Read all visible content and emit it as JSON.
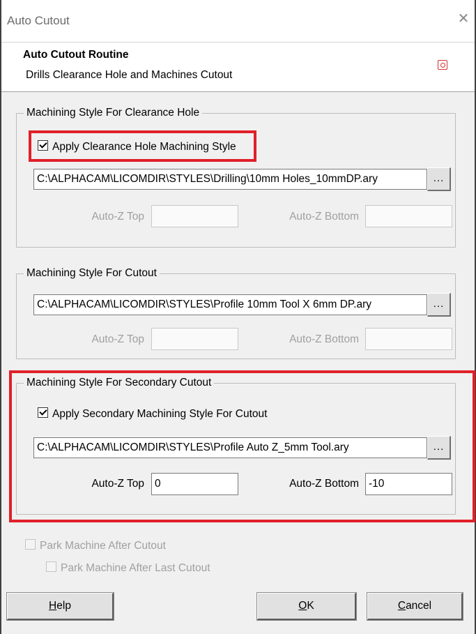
{
  "window": {
    "title": "Auto Cutout"
  },
  "header": {
    "heading": "Auto Cutout Routine",
    "subheading": "Drills Clearance Hole and Machines Cutout"
  },
  "clearance_group": {
    "label": "Machining Style For Clearance Hole",
    "checkbox_label": "Apply Clearance Hole Machining Style",
    "checked": true,
    "style_path": "C:\\ALPHACAM\\LICOMDIR\\STYLES\\Drilling\\10mm Holes_10mmDP.ary",
    "browse_label": "...",
    "autoz_top_label": "Auto-Z Top",
    "autoz_top_value": "",
    "autoz_bottom_label": "Auto-Z Bottom",
    "autoz_bottom_value": "",
    "autoz_enabled": false
  },
  "cutout_group": {
    "label": "Machining Style For Cutout",
    "style_path": "C:\\ALPHACAM\\LICOMDIR\\STYLES\\Profile 10mm Tool X 6mm DP.ary",
    "browse_label": "...",
    "autoz_top_label": "Auto-Z Top",
    "autoz_top_value": "",
    "autoz_bottom_label": "Auto-Z Bottom",
    "autoz_bottom_value": "",
    "autoz_enabled": false
  },
  "secondary_group": {
    "label": "Machining Style For Secondary Cutout",
    "checkbox_label": "Apply Secondary Machining Style For Cutout",
    "checked": true,
    "style_path": "C:\\ALPHACAM\\LICOMDIR\\STYLES\\Profile Auto Z_5mm Tool.ary",
    "browse_label": "...",
    "autoz_top_label": "Auto-Z Top",
    "autoz_top_value": "0",
    "autoz_bottom_label": "Auto-Z Bottom",
    "autoz_bottom_value": "-10",
    "autoz_enabled": true
  },
  "park": {
    "after_cutout_label": "Park Machine After Cutout",
    "after_last_cutout_label": "Park Machine After Last Cutout",
    "enabled": false,
    "after_cutout_checked": false,
    "after_last_cutout_checked": false
  },
  "buttons": {
    "help": {
      "mnemonic": "H",
      "rest": "elp"
    },
    "ok": {
      "mnemonic": "O",
      "rest": "K"
    },
    "cancel": {
      "mnemonic": "C",
      "rest": "ancel"
    }
  },
  "icons": {
    "close": "close-icon",
    "help": "help-icon",
    "check": "checkmark"
  },
  "colors": {
    "highlight": "#e0202a",
    "dialog_bg": "#f0f0f0",
    "disabled_text": "#a0a0a0"
  }
}
